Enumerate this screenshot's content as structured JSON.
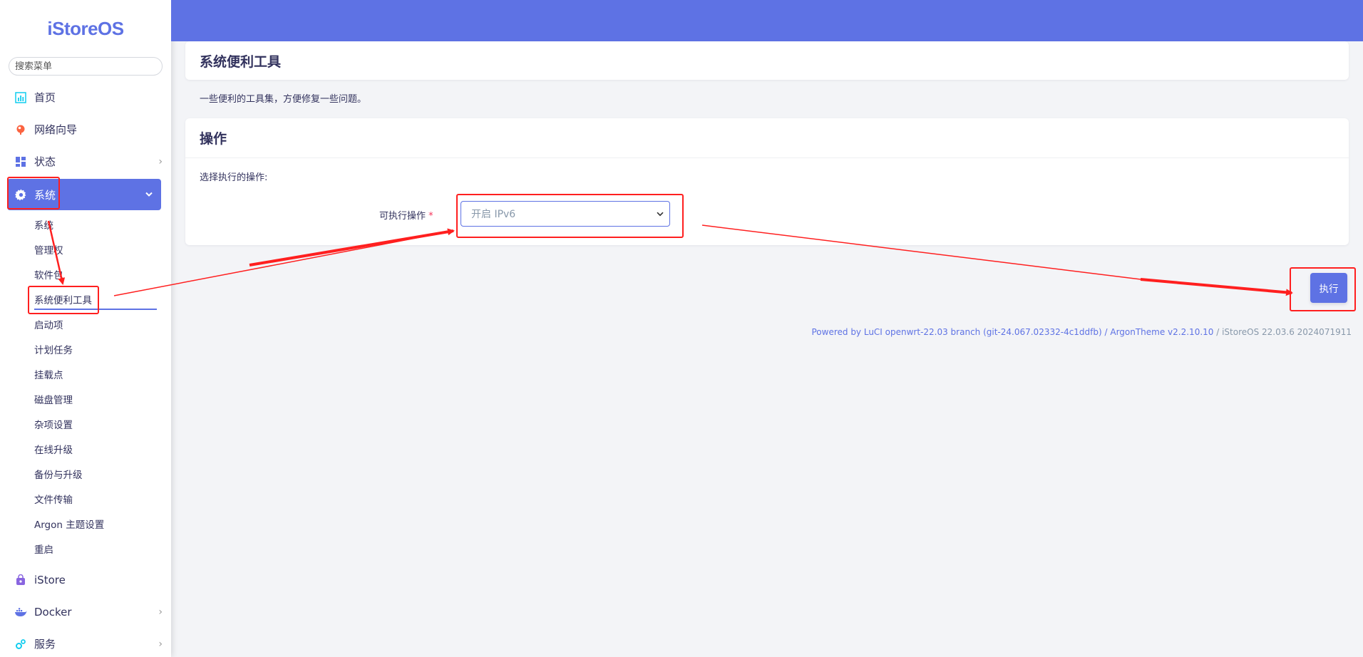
{
  "sidebar": {
    "logo": "iStoreOS",
    "search_placeholder": "搜索菜单",
    "items": [
      {
        "label": "首页",
        "icon": "chart-icon"
      },
      {
        "label": "网络向导",
        "icon": "globe-icon"
      },
      {
        "label": "状态",
        "icon": "dashboard-icon"
      },
      {
        "label": "系统",
        "icon": "gear-icon"
      }
    ],
    "sub_items": [
      "系统",
      "管理权",
      "软件包",
      "系统便利工具",
      "启动项",
      "计划任务",
      "挂载点",
      "磁盘管理",
      "杂项设置",
      "在线升级",
      "备份与升级",
      "文件传输",
      "Argon 主题设置",
      "重启"
    ],
    "bottom_items": [
      {
        "label": "iStore",
        "icon": "store-icon"
      },
      {
        "label": "Docker",
        "icon": "docker-icon"
      },
      {
        "label": "服务",
        "icon": "services-icon"
      }
    ]
  },
  "page": {
    "title": "系统便利工具",
    "description": "一些便利的工具集，方便修复一些问题。"
  },
  "operation": {
    "header": "操作",
    "subtitle": "选择执行的操作:",
    "field_label": "可执行操作",
    "required_mark": "*",
    "selected_value": "开启 IPv6",
    "execute_label": "执行"
  },
  "footer": {
    "powered": "Powered by LuCI openwrt-22.03 branch (git-24.067.02332-4c1ddfb) / ArgonTheme v2.2.10.10",
    "version": " / iStoreOS 22.03.6 2024071911"
  },
  "colors": {
    "accent": "#5e72e4",
    "annotation": "#ff1f1f"
  }
}
